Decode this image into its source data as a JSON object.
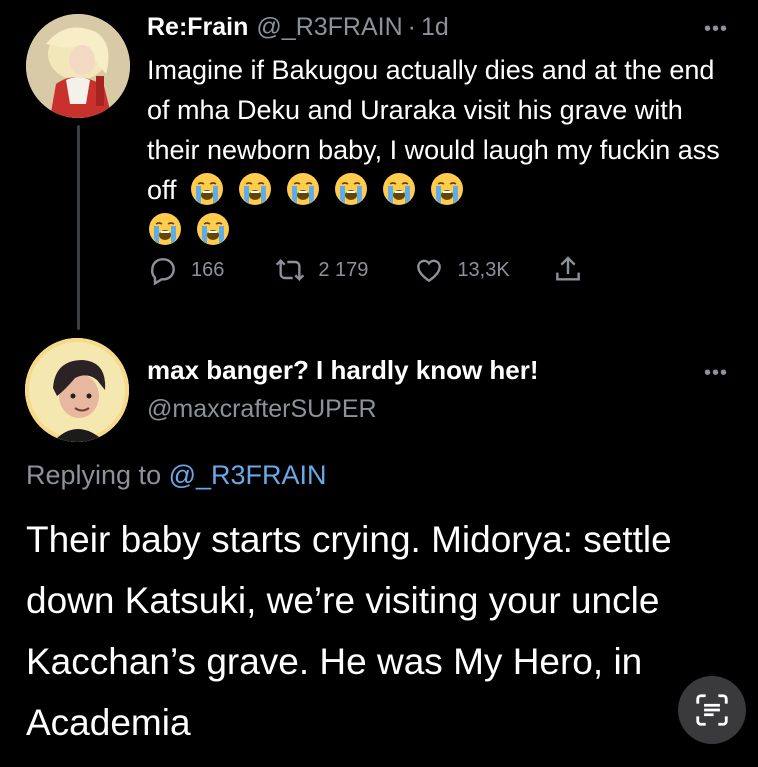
{
  "tweet1": {
    "name": "Re:Frain",
    "handle": "@_R3FRAIN",
    "dot": "·",
    "time": "1d",
    "text": "Imagine if Bakugou actually dies and at the end of mha Deku and Uraraka visit his grave with their newborn baby, I would laugh my fuckin ass off",
    "emoji": "loudly-crying-face",
    "emoji_count": 8,
    "stats": {
      "replies": "166",
      "retweets": "2 179",
      "likes": "13,3K"
    }
  },
  "tweet2": {
    "name": "max banger? I hardly know her!",
    "handle": "@maxcrafterSUPER",
    "replying_prefix": "Replying to",
    "replying_handle": "@_R3FRAIN",
    "text": "Their baby starts crying. Midorya: settle down Katsuki, we’re visiting your uncle Kacchan’s grave. He was My Hero, in Academia"
  },
  "more_label": "•••",
  "colors": {
    "background": "#000000",
    "secondary_text": "#8b9299",
    "link": "#6aa9e8"
  },
  "icons": [
    "reply-icon",
    "retweet-icon",
    "like-icon",
    "share-icon",
    "text-scan-icon"
  ]
}
